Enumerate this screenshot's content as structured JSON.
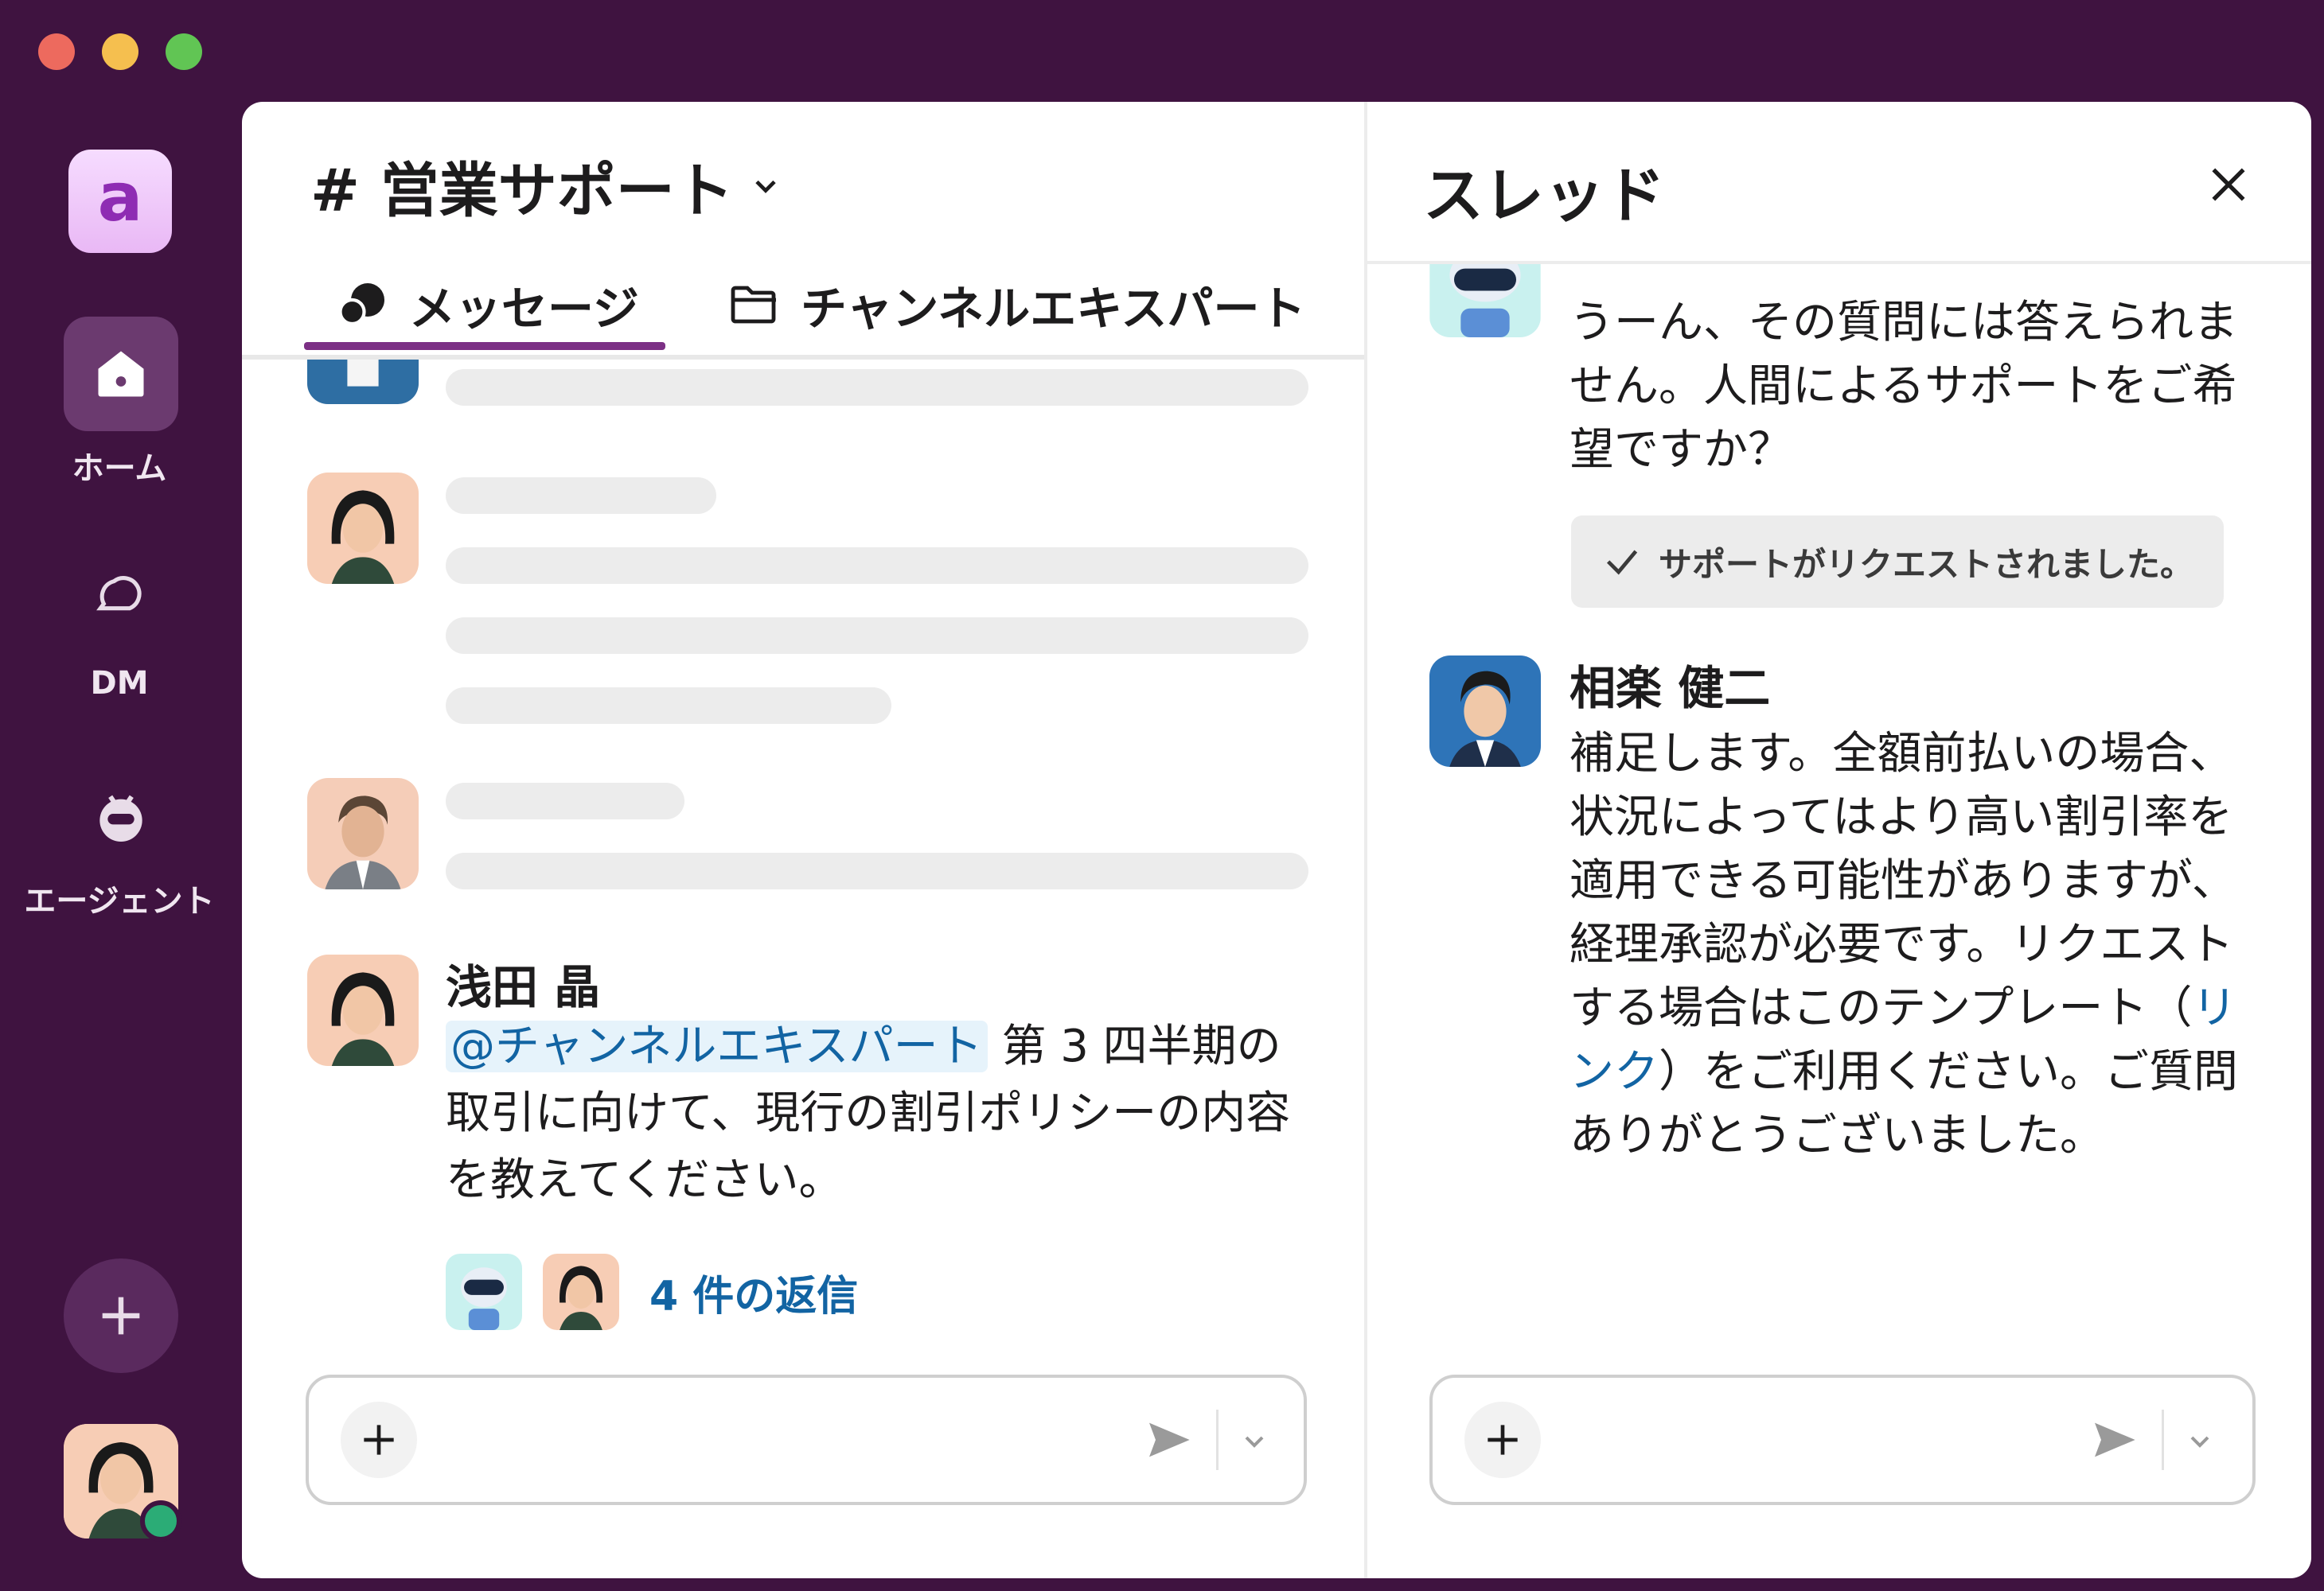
{
  "sidebar": {
    "logo_letter": "a",
    "items": [
      {
        "label": "ホーム"
      },
      {
        "label": "DM"
      },
      {
        "label": "エージェント"
      }
    ]
  },
  "channel": {
    "title": "# 営業サポート",
    "tabs": [
      {
        "label": "メッセージ"
      },
      {
        "label": "チャンネルエキスパート"
      }
    ],
    "message": {
      "author": "浅田 晶",
      "mention": "@チャンネルエキスパート",
      "text": " 第 3 四半期の取引に向けて、現行の割引ポリシーの内容を教えてください。",
      "replies_label": "4 件の返信"
    }
  },
  "thread": {
    "title": "スレッド",
    "bot_message": "うーん、その質問には答えられません。人間によるサポートをご希望ですか？",
    "support_status": "サポートがリクエストされました。",
    "reply": {
      "author": "相楽 健二",
      "text_before": "補足します。全額前払いの場合、状況によってはより高い割引率を適用できる可能性がありますが、経理承認が必要です。リクエストする場合はこのテンプレート（",
      "link": "リンク",
      "text_after": "）をご利用ください。ご質問ありがとうございました。"
    }
  },
  "colors": {
    "sidebar_bg": "#3f1340",
    "accent": "#7c3085",
    "link": "#1264a3",
    "presence": "#2bac76"
  }
}
